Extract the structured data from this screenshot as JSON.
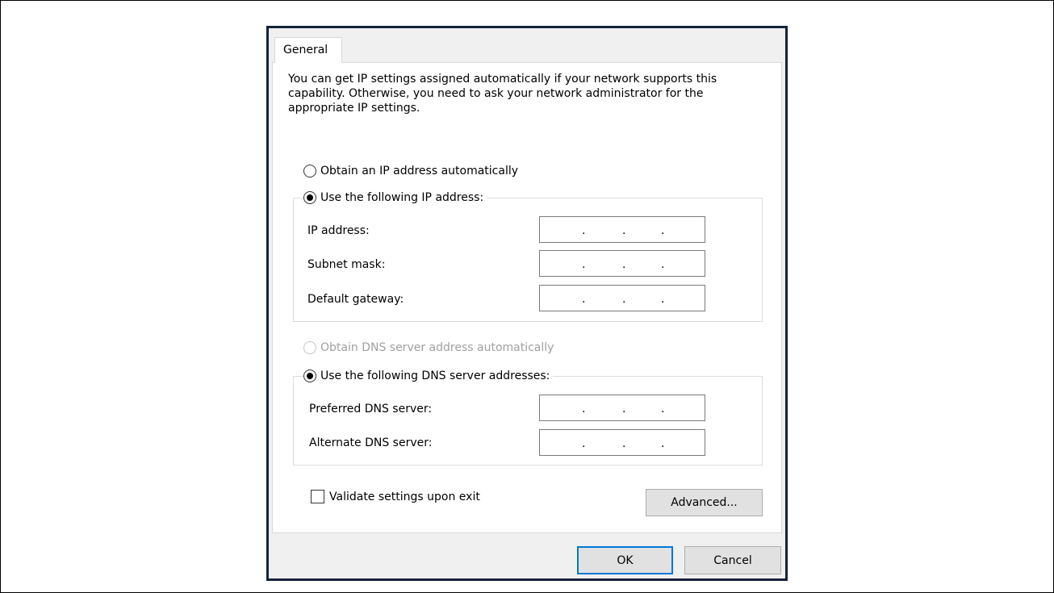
{
  "tabs": [
    {
      "label": "General"
    }
  ],
  "intro": "You can get IP settings assigned automatically if your network supports this capability. Otherwise, you need to ask your network administrator for the appropriate IP settings.",
  "ip": {
    "auto_label": "Obtain an IP address automatically",
    "auto_selected": false,
    "manual_label": "Use the following IP address:",
    "manual_selected": true,
    "fields": [
      {
        "label": "IP address:",
        "value": ""
      },
      {
        "label": "Subnet mask:",
        "value": ""
      },
      {
        "label": "Default gateway:",
        "value": ""
      }
    ]
  },
  "dns": {
    "auto_label": "Obtain DNS server address automatically",
    "auto_selected": false,
    "auto_disabled": true,
    "manual_label": "Use the following DNS server addresses:",
    "manual_selected": true,
    "fields": [
      {
        "label": "Preferred DNS server:",
        "value": ""
      },
      {
        "label": "Alternate DNS server:",
        "value": ""
      }
    ]
  },
  "validate": {
    "label": "Validate settings upon exit",
    "checked": false
  },
  "buttons": {
    "advanced": "Advanced...",
    "ok": "OK",
    "cancel": "Cancel"
  },
  "colors": {
    "dialog_border": "#14233a",
    "focus_border": "#0078d7",
    "disabled_text": "#a0a0a0"
  }
}
